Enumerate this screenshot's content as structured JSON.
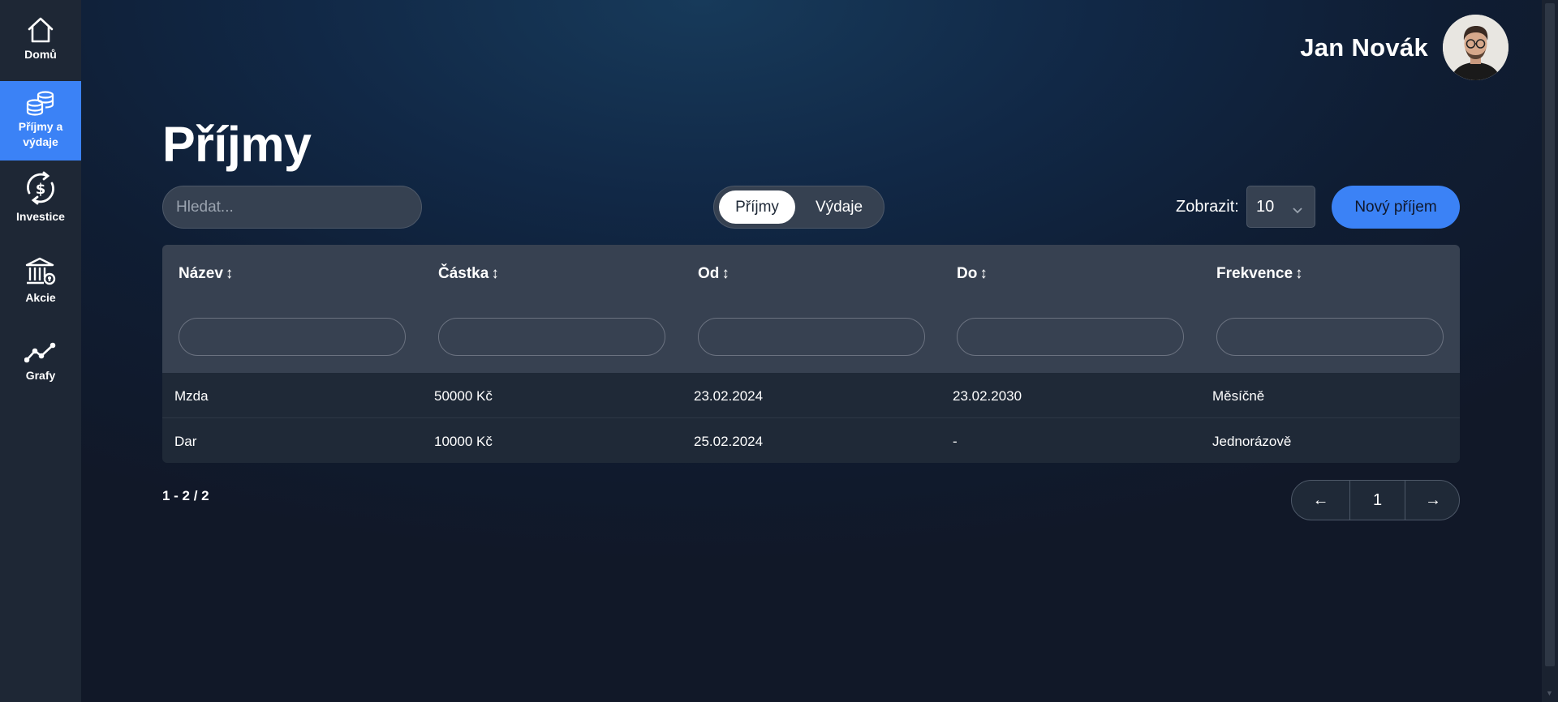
{
  "sidebar": {
    "items": [
      {
        "label": "Domů",
        "icon": "home-icon"
      },
      {
        "label": "Příjmy a výdaje",
        "icon": "coins-icon",
        "active": true
      },
      {
        "label": "Investice",
        "icon": "dollar-cycle-icon"
      },
      {
        "label": "Akcie",
        "icon": "bank-icon"
      },
      {
        "label": "Grafy",
        "icon": "line-chart-icon"
      }
    ]
  },
  "header": {
    "user_name": "Jan Novák",
    "avatar_icon": "user-avatar"
  },
  "page": {
    "title": "Příjmy"
  },
  "toolbar": {
    "search_placeholder": "Hledat...",
    "toggle": {
      "options": [
        "Příjmy",
        "Výdaje"
      ],
      "selected": "Příjmy"
    },
    "show_label": "Zobrazit:",
    "page_size": "10",
    "new_button": "Nový příjem"
  },
  "table": {
    "columns": [
      "Název",
      "Částka",
      "Od",
      "Do",
      "Frekvence"
    ],
    "sort_glyph": "↕",
    "rows": [
      [
        "Mzda",
        "50000 Kč",
        "23.02.2024",
        "23.02.2030",
        "Měsíčně"
      ],
      [
        "Dar",
        "10000 Kč",
        "25.02.2024",
        "-",
        "Jednorázově"
      ]
    ]
  },
  "pagination": {
    "range_text": "1 - 2 / 2",
    "prev": "←",
    "current": "1",
    "next": "→"
  },
  "colors": {
    "accent": "#3b82f6",
    "sidebar_bg": "#1e2735",
    "table_header_bg": "#374151",
    "table_row_bg": "#1f2937"
  }
}
